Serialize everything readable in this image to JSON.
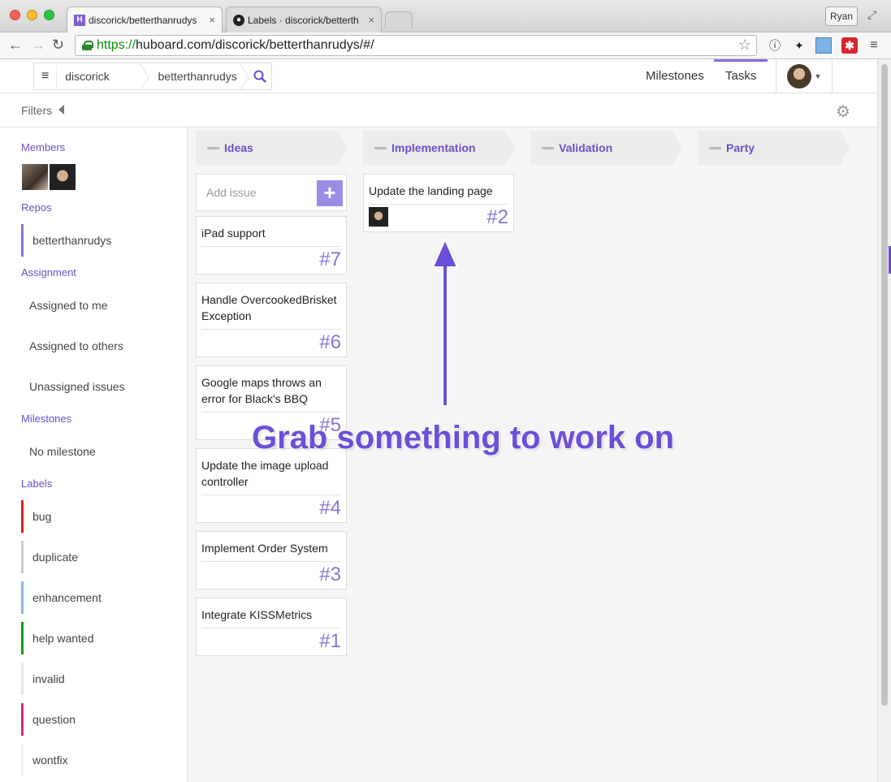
{
  "browser": {
    "tabs": [
      {
        "title": "discorick/betterthanrudys",
        "close": "×",
        "favicon": "H"
      },
      {
        "title": "Labels · discorick/betterth",
        "close": "×",
        "favicon": "●"
      }
    ],
    "profile": "Ryan",
    "url_scheme": "https://",
    "url_rest": "huboard.com/discorick/betterthanrudys/#/"
  },
  "nav": {
    "owner": "discorick",
    "repo": "betterthanrudys",
    "milestones": "Milestones",
    "tasks": "Tasks"
  },
  "filters": {
    "label": "Filters"
  },
  "sidebar": {
    "members_heading": "Members",
    "repos_heading": "Repos",
    "repo_item": "betterthanrudys",
    "assignment_heading": "Assignment",
    "assignment_items": [
      "Assigned to me",
      "Assigned to others",
      "Unassigned issues"
    ],
    "milestones_heading": "Milestones",
    "milestone_items": [
      "No milestone"
    ],
    "labels_heading": "Labels",
    "labels": [
      {
        "name": "bug",
        "color": "#e11d21"
      },
      {
        "name": "duplicate",
        "color": "#cccccc"
      },
      {
        "name": "enhancement",
        "color": "#84b6eb"
      },
      {
        "name": "help wanted",
        "color": "#159818"
      },
      {
        "name": "invalid",
        "color": "#e6e6e6"
      },
      {
        "name": "question",
        "color": "#cc317c"
      },
      {
        "name": "wontfix",
        "color": "#ffffff"
      }
    ]
  },
  "board": {
    "columns": [
      "Ideas",
      "Implementation",
      "Validation",
      "Party"
    ],
    "add_issue_placeholder": "Add issue",
    "add_issue_button": "+",
    "ideas_cards": [
      {
        "title": "iPad support",
        "number": "#7"
      },
      {
        "title": "Handle OvercookedBrisket Exception",
        "number": "#6"
      },
      {
        "title": "Google maps throws an error for Black's BBQ",
        "number": "#5"
      },
      {
        "title": "Update the image upload controller",
        "number": "#4"
      },
      {
        "title": "Implement Order System",
        "number": "#3"
      },
      {
        "title": "Integrate KISSMetrics",
        "number": "#1"
      }
    ],
    "implementation_cards": [
      {
        "title": "Update the landing page",
        "number": "#2"
      }
    ]
  },
  "annotation": {
    "text": "Grab something to work on",
    "color": "#6c4fd8"
  },
  "colors": {
    "accent": "#6c4fc7",
    "issue_number": "#8a74d6"
  }
}
